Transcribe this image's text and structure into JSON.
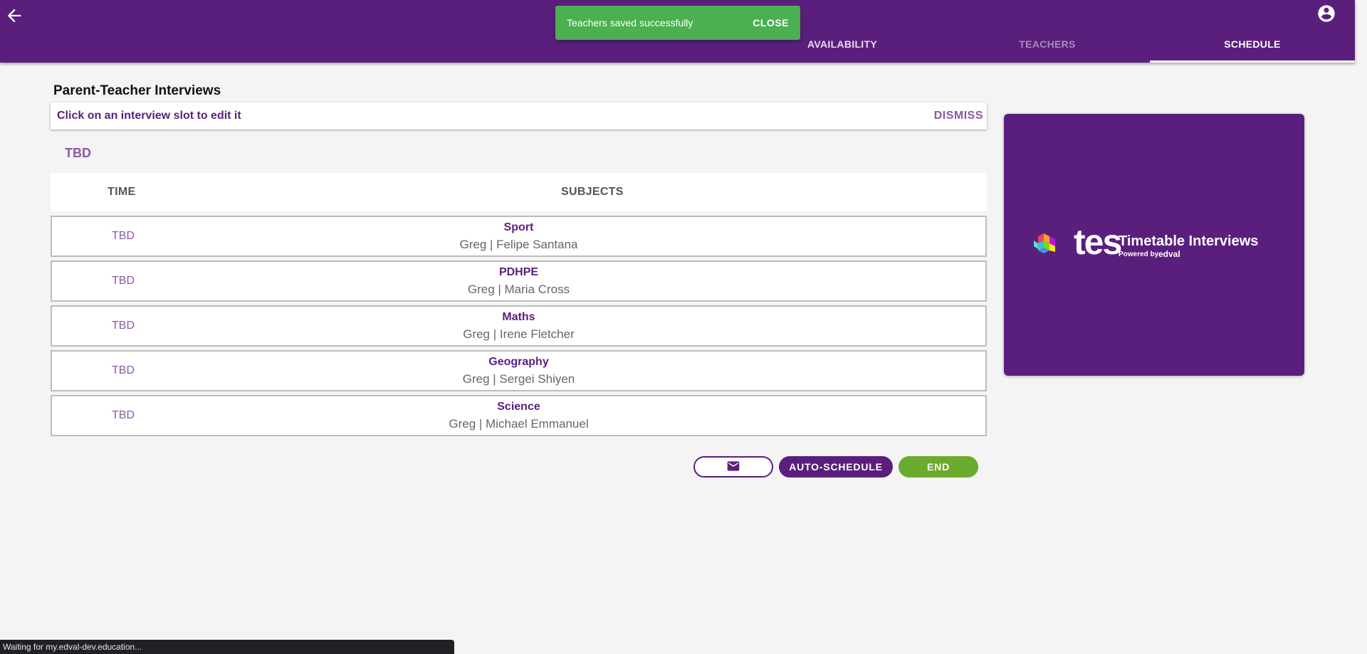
{
  "appbar": {
    "tabs": [
      {
        "label": "AVAILABILITY"
      },
      {
        "label": "TEACHERS"
      },
      {
        "label": "SCHEDULE"
      }
    ],
    "active_tab": "SCHEDULE",
    "color": "#5a1f7c"
  },
  "snackbar": {
    "message": "Teachers saved successfully",
    "close_label": "CLOSE",
    "color": "#4caf50"
  },
  "page": {
    "title": "Parent-Teacher Interviews",
    "hint": "Click on an interview slot to edit it",
    "dismiss_label": "DISMISS",
    "section_label": "TBD"
  },
  "table": {
    "columns": [
      "TIME",
      "SUBJECTS"
    ],
    "rows": [
      {
        "time": "TBD",
        "subject": "Sport",
        "teacher": "Greg | Felipe Santana"
      },
      {
        "time": "TBD",
        "subject": "PDHPE",
        "teacher": "Greg | Maria Cross"
      },
      {
        "time": "TBD",
        "subject": "Maths",
        "teacher": "Greg | Irene Fletcher"
      },
      {
        "time": "TBD",
        "subject": "Geography",
        "teacher": "Greg | Sergei Shiyen"
      },
      {
        "time": "TBD",
        "subject": "Science",
        "teacher": "Greg | Michael Emmanuel"
      }
    ]
  },
  "actions": {
    "mail_icon": "mail-icon",
    "auto_schedule_label": "AUTO-SCHEDULE",
    "end_label": "END",
    "end_color": "#6aaa2d"
  },
  "brand": {
    "word": "tes",
    "title": "Timetable Interviews",
    "powered_by": "Powered by",
    "partner": "edval"
  },
  "statusbar": {
    "text": "Waiting for my.edval-dev.education..."
  }
}
